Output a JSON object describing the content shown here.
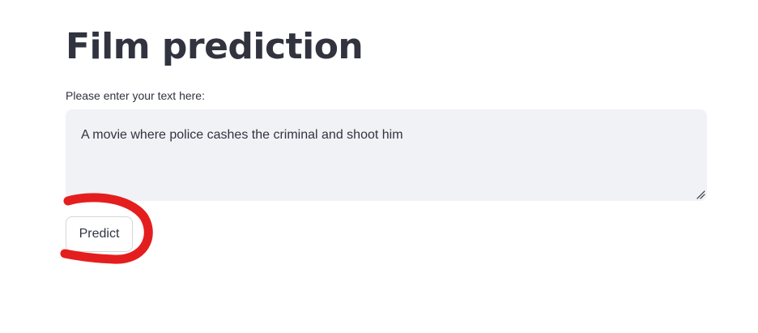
{
  "page": {
    "title": "Film prediction"
  },
  "form": {
    "label": "Please enter your text here:",
    "text_value": "A movie where police cashes the criminal and shoot him",
    "predict_label": "Predict"
  },
  "colors": {
    "text": "#31333f",
    "input_background": "#f0f2f6",
    "button_border": "#d6d6d9",
    "annotation_stroke": "#e41e1e"
  },
  "icons": {
    "resize_handle": "resize-handle-icon"
  }
}
